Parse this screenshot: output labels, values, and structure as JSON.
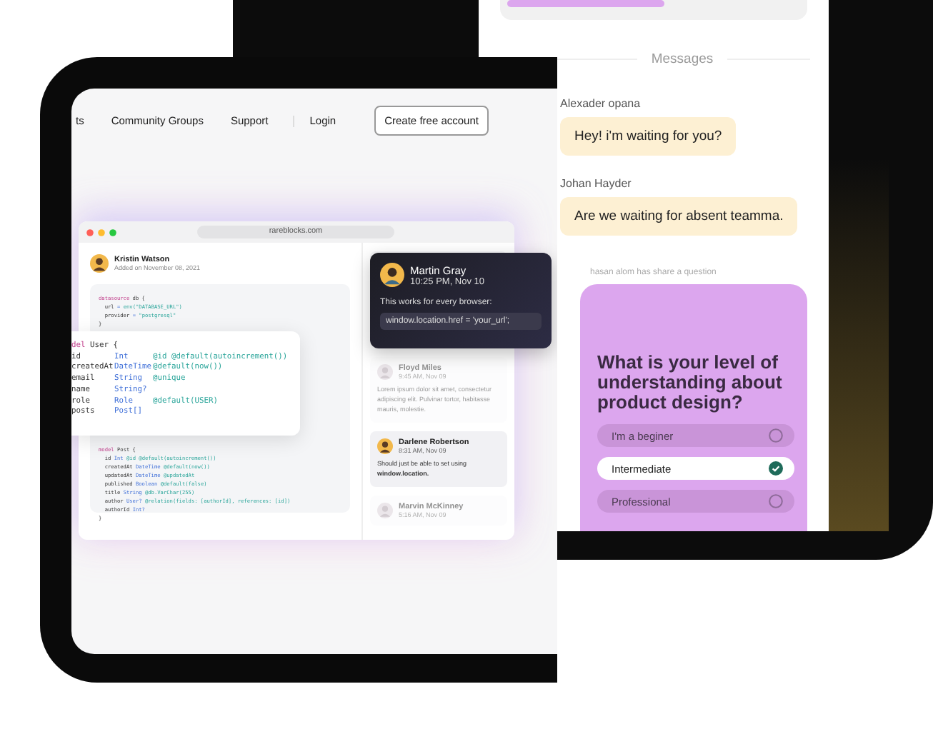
{
  "front_screen": {
    "nav": {
      "items": [
        "ts",
        "Community Groups",
        "Support",
        "Login"
      ],
      "button": "Create free account"
    },
    "browser": {
      "url": "rareblocks.com",
      "post": {
        "author": "Kristin Watson",
        "date": "Added on November 08, 2021"
      },
      "code_blocks": [
        {
          "keyword": "datasource",
          "name": "db {",
          "rows": [
            {
              "name": "url",
              "type": "=",
              "attr": "env(\"DATABASE_URL\")"
            },
            {
              "name": "provider",
              "type": "=",
              "attr": "\"postgresql\""
            }
          ],
          "footer": "}"
        },
        {
          "keyword": "model",
          "name": "Post {",
          "rows": [
            {
              "name": "id",
              "type": "Int",
              "attr": "@id @default(autoincrement())"
            },
            {
              "name": "createdAt",
              "type": "DateTime",
              "attr": "@default(now())"
            },
            {
              "name": "updatedAt",
              "type": "DateTime",
              "attr": "@updatedAt"
            },
            {
              "name": "published",
              "type": "Boolean",
              "attr": "@default(false)"
            },
            {
              "name": "title",
              "type": "String",
              "attr": "@db.VarChar(255)"
            },
            {
              "name": "author",
              "type": "User?",
              "attr": "@relation(fields: [authorId], references: [id])"
            },
            {
              "name": "authorId",
              "type": "Int?",
              "attr": ""
            }
          ],
          "footer": "}"
        }
      ],
      "comments": [
        {
          "name": "Floyd Miles",
          "time": "9:45 AM, Nov 09",
          "text": "Lorem ipsum dolor sit amet, consectetur adipiscing elit. Pulvinar tortor, habitasse mauris, molestie.",
          "dimmed": true
        },
        {
          "name": "Darlene Robertson",
          "time": "8:31 AM, Nov 09",
          "text": "Should just be able to set using **window.location.**",
          "dimmed": false
        },
        {
          "name": "Marvin McKinney",
          "time": "5:16 AM, Nov 09",
          "dimmed": true
        }
      ]
    },
    "code_card": {
      "keyword": "del",
      "name": "User {",
      "rows": [
        {
          "name": "id",
          "type": "Int",
          "attr": "@id @default(autoincrement())"
        },
        {
          "name": "createdAt",
          "type": "DateTime",
          "attr": "@default(now())"
        },
        {
          "name": "email",
          "type": "String",
          "attr": "@unique"
        },
        {
          "name": "name",
          "type": "String?",
          "attr": ""
        },
        {
          "name": "role",
          "type": "Role",
          "attr": "@default(USER)"
        },
        {
          "name": "posts",
          "type": "Post[]",
          "attr": ""
        }
      ]
    },
    "reply_card": {
      "name": "Martin Gray",
      "time": "10:25 PM, Nov 10",
      "text": "This works for every browser:",
      "code": "window.location.href = 'your_url';"
    }
  },
  "back_screen": {
    "heading": "Messages",
    "messages": [
      {
        "sender": "Alexader opana",
        "text": "Hey! i'm waiting for you?"
      },
      {
        "sender": "Johan Hayder",
        "text": "Are we waiting for absent teamma."
      }
    ],
    "notice": "hasan alom has share a question",
    "question": {
      "text": "What is your level of understanding about product design?",
      "options": [
        {
          "label": "I'm a beginer",
          "selected": false
        },
        {
          "label": "Intermediate",
          "selected": true
        },
        {
          "label": "Professional",
          "selected": false
        }
      ]
    }
  }
}
